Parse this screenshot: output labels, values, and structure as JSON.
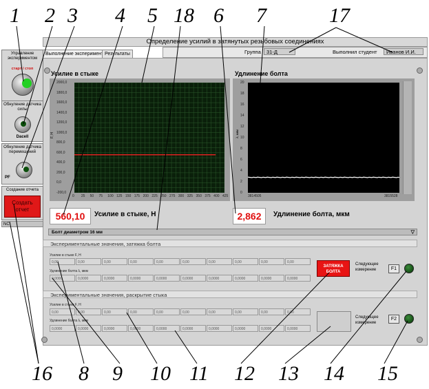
{
  "title": "Определение усилий в затянутых резьбовых соединениях",
  "group_label": "Группа",
  "group_value": "31-Д",
  "student_label": "Выполнил студент",
  "student_value": "Иванов И.И.",
  "tabs": [
    "Выполнение эксперимента",
    "Результаты"
  ],
  "sidebar": {
    "control1": {
      "label": "Управление экспериментом",
      "sublabel": "старт / стоп"
    },
    "control2": {
      "label": "Обнуление датчика силы",
      "sublabel": "Dacell"
    },
    "control3": {
      "label": "Обнуление датчика перемещений",
      "sublabel": "PF"
    },
    "control4": {
      "label": "Создание отчета",
      "button": "Создать отчет"
    },
    "status": "NC"
  },
  "force_graph": {
    "title": "Усилие в стыке",
    "ylabel": "F, Н",
    "yticks": [
      "2000,0",
      "1800,0",
      "1600,0",
      "1400,0",
      "1200,0",
      "1000,0",
      "800,0",
      "600,0",
      "400,0",
      "200,0",
      "0,0",
      "-200,0"
    ],
    "xticks": [
      "0",
      "25",
      "50",
      "75",
      "100",
      "125",
      "150",
      "175",
      "200",
      "225",
      "250",
      "275",
      "300",
      "325",
      "350",
      "375",
      "400",
      "425"
    ]
  },
  "elong_graph": {
    "title": "Удлинение болта",
    "ylabel": "λ, мкм",
    "yticks": [
      "20",
      "18",
      "16",
      "14",
      "12",
      "10",
      "8",
      "6",
      "4",
      "2",
      "0"
    ],
    "xmin": "3814505",
    "xmax": "3815528"
  },
  "chart_data": [
    {
      "type": "line",
      "title": "Усилие в стыке",
      "xlabel": "",
      "ylabel": "F, Н",
      "xlim": [
        0,
        425
      ],
      "ylim": [
        -200,
        2000
      ],
      "series": [
        {
          "x": [
            0,
            400
          ],
          "y": [
            560,
            560
          ]
        }
      ]
    },
    {
      "type": "line",
      "title": "Удлинение болта",
      "xlabel": "",
      "ylabel": "λ, мкм",
      "xlim": [
        3814505,
        3815528
      ],
      "ylim": [
        0,
        20
      ],
      "series": [
        {
          "x": [
            3814505,
            3815528
          ],
          "y": [
            2.8,
            2.8
          ]
        }
      ]
    }
  ],
  "readouts": {
    "force_value": "560,10",
    "force_label": "Усилие в стыке, Н",
    "elong_value": "2,862",
    "elong_label": "Удлинение болта, мкм"
  },
  "bolt_select": "Болт диаметром 16 мм",
  "section1": {
    "header": "Экспериментальные значения, затяжка болта",
    "row1_label": "Усилие в стыке F, Н",
    "row2_label": "Удлинение болта λ, мкм",
    "row1_cells": [
      "0,00",
      "0,00",
      "0,00",
      "0,00",
      "0,00",
      "0,00",
      "0,00",
      "0,00",
      "0,00",
      "0,00"
    ],
    "row2_cells": [
      "0,0000",
      "0,0000",
      "0,0000",
      "0,0000",
      "0,0000",
      "0,0000",
      "0,0000",
      "0,0000",
      "0,0000",
      "0,0000"
    ],
    "button": "ЗАТЯЖКА БОЛТА",
    "next_label": "Следующее измерение",
    "key": "F1"
  },
  "section2": {
    "header": "Экспериментальные значения, раскрытие стыка",
    "row1_label": "Усилие в стыке F, Н",
    "row2_label": "Удлинение болта λ, мкм",
    "row1_cells": [
      "0,00",
      "0,00",
      "0,00",
      "0,00",
      "0,00",
      "0,00",
      "0,00",
      "0,00",
      "0,00",
      "0,00"
    ],
    "row2_cells": [
      "0,0000",
      "0,0000",
      "0,0000",
      "0,0000",
      "0,0000",
      "0,0000",
      "0,0000",
      "0,0000",
      "0,0000",
      "0,0000"
    ],
    "next_label": "Следующее измерение",
    "key": "F2"
  },
  "callouts_top": [
    "1",
    "2",
    "3",
    "4",
    "5",
    "18",
    "6",
    "7",
    "17"
  ],
  "callouts_bottom": [
    "16",
    "8",
    "9",
    "10",
    "11",
    "12",
    "13",
    "14",
    "15"
  ],
  "colors": {
    "force_line": "#e02020",
    "led_on": "#20d020",
    "led_off": "#0c5a0c",
    "accent_red": "#e01010"
  }
}
